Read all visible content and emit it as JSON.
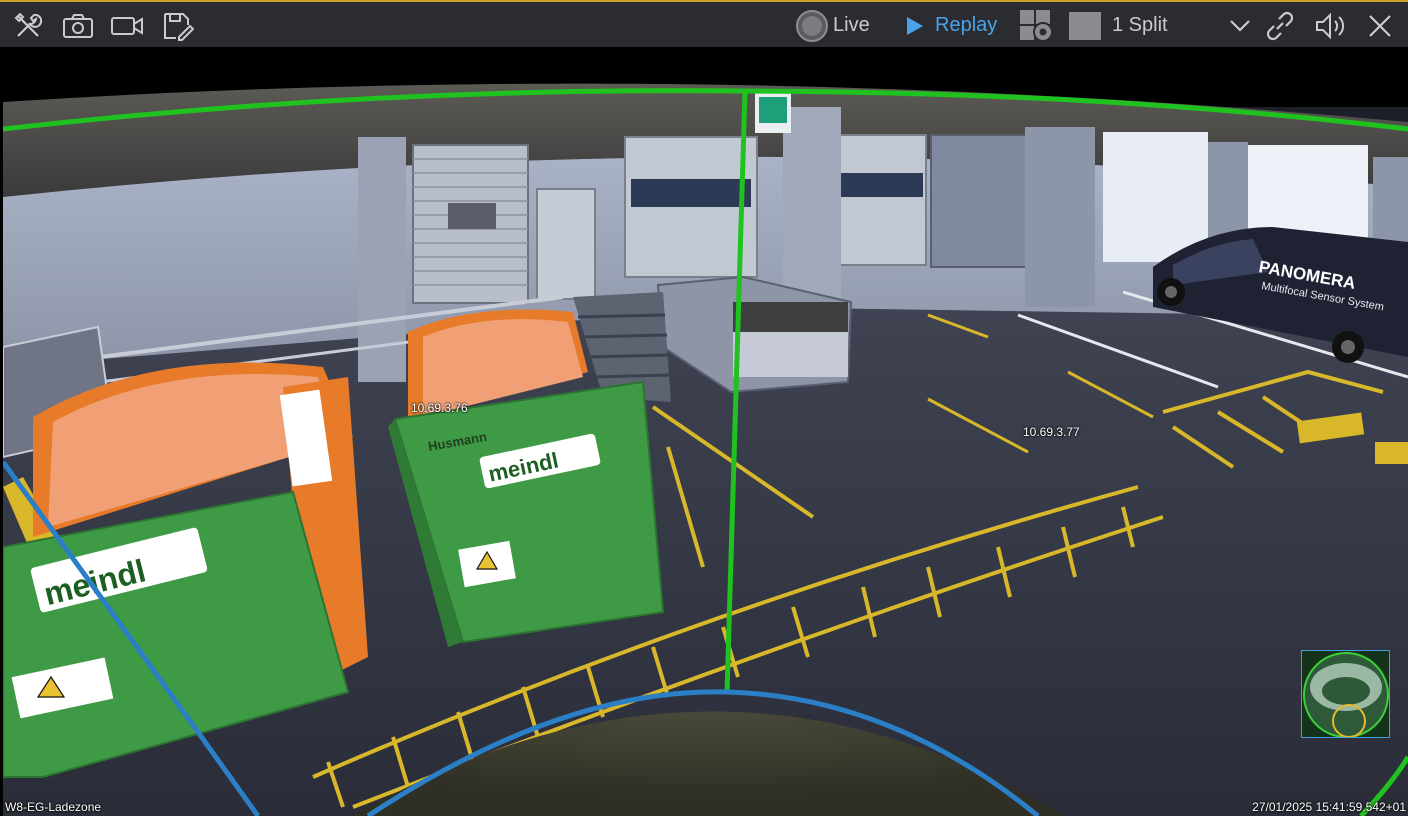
{
  "toolbar": {
    "tools_icon": "tools-icon",
    "snapshot_icon": "camera-icon",
    "record_icon": "video-camera-icon",
    "save_icon": "save-edit-icon",
    "live_label": "Live",
    "replay_label": "Replay",
    "split_label": "1 Split",
    "settings_icon": "grid-gear-icon",
    "layout_icon": "square-icon",
    "dropdown_icon": "chevron-down-icon",
    "link_icon": "link-icon",
    "audio_icon": "speaker-icon",
    "close_icon": "close-icon"
  },
  "overlay": {
    "ip_left": "10.69.3.76",
    "ip_right": "10.69.3.77",
    "camera_name": "W8-EG-Ladezone",
    "timestamp": "27/01/2025 15:41:59.542+01"
  },
  "scene": {
    "container_brand": "meindl",
    "container_maker": "Husmann",
    "van_brand": "PANOMERA",
    "van_subtitle": "Multifocal Sensor System"
  },
  "colors": {
    "toolbar_bg": "#2a2c31",
    "accent_top": "#c9a227",
    "replay_blue": "#4aa3e8",
    "zone_green": "#1fc21f",
    "zone_blue": "#2a7fc6",
    "container_green": "#3f9a45",
    "container_orange": "#e77b2a"
  }
}
